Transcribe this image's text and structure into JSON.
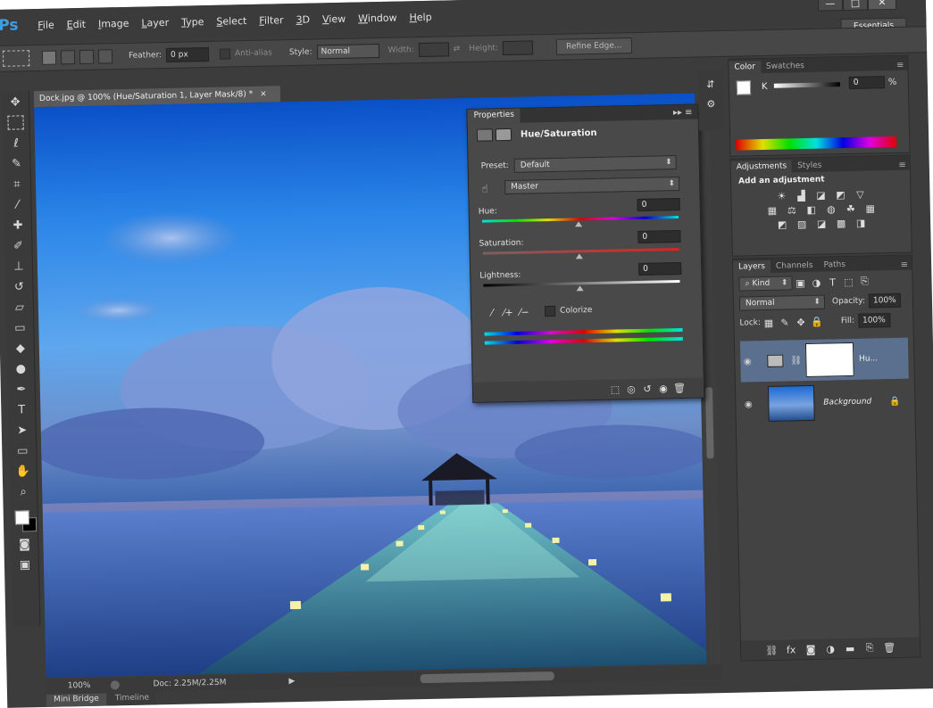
{
  "app": {
    "logo": "Ps"
  },
  "menu": [
    "File",
    "Edit",
    "Image",
    "Layer",
    "Type",
    "Select",
    "Filter",
    "3D",
    "View",
    "Window",
    "Help"
  ],
  "window_controls": {
    "minimize": "—",
    "maximize": "□",
    "close": "✕"
  },
  "workspace": {
    "label": "Essentials"
  },
  "options_bar": {
    "feather_label": "Feather:",
    "feather_value": "0 px",
    "antialias_label": "Anti-alias",
    "style_label": "Style:",
    "style_value": "Normal",
    "width_label": "Width:",
    "height_label": "Height:",
    "refine_edge": "Refine Edge..."
  },
  "document": {
    "tab_title": "Dock.jpg @ 100% (Hue/Saturation 1, Layer Mask/8) *",
    "tab_close": "×"
  },
  "status_bar": {
    "zoom": "100%",
    "doc_size": "Doc: 2.25M/2.25M"
  },
  "bottom_tabs": [
    "Mini Bridge",
    "Timeline"
  ],
  "properties": {
    "tab": "Properties",
    "title": "Hue/Saturation",
    "preset_label": "Preset:",
    "preset_value": "Default",
    "channel_value": "Master",
    "hue_label": "Hue:",
    "hue_value": "0",
    "saturation_label": "Saturation:",
    "saturation_value": "0",
    "lightness_label": "Lightness:",
    "lightness_value": "0",
    "colorize_label": "Colorize",
    "colorize_checked": false
  },
  "color_panel": {
    "tabs": [
      "Color",
      "Swatches"
    ],
    "channel_label": "K",
    "value": "0",
    "unit": "%"
  },
  "adjustments_panel": {
    "tabs": [
      "Adjustments",
      "Styles"
    ],
    "heading": "Add an adjustment"
  },
  "layers_panel": {
    "tabs": [
      "Layers",
      "Channels",
      "Paths"
    ],
    "filter_kind": "Kind",
    "blend_mode": "Normal",
    "opacity_label": "Opacity:",
    "opacity_value": "100%",
    "lock_label": "Lock:",
    "fill_label": "Fill:",
    "fill_value": "100%",
    "layers": [
      {
        "name": "Hu...",
        "visible": true
      },
      {
        "name": "Background",
        "visible": true
      }
    ]
  },
  "colors": {
    "ps_blue": "#3c9ee5",
    "ui_bg": "#3c3c3c",
    "panel_bg": "#434343",
    "selected_layer": "#5b6f8e"
  },
  "icons": {
    "tools": [
      "move-icon",
      "marquee-icon",
      "lasso-icon",
      "quick-select-icon",
      "crop-icon",
      "eyedropper-icon",
      "healing-icon",
      "brush-icon",
      "stamp-icon",
      "history-brush-icon",
      "eraser-icon",
      "gradient-icon",
      "blur-icon",
      "dodge-icon",
      "pen-icon",
      "type-icon",
      "path-select-icon",
      "shape-icon",
      "hand-icon",
      "zoom-icon"
    ]
  }
}
